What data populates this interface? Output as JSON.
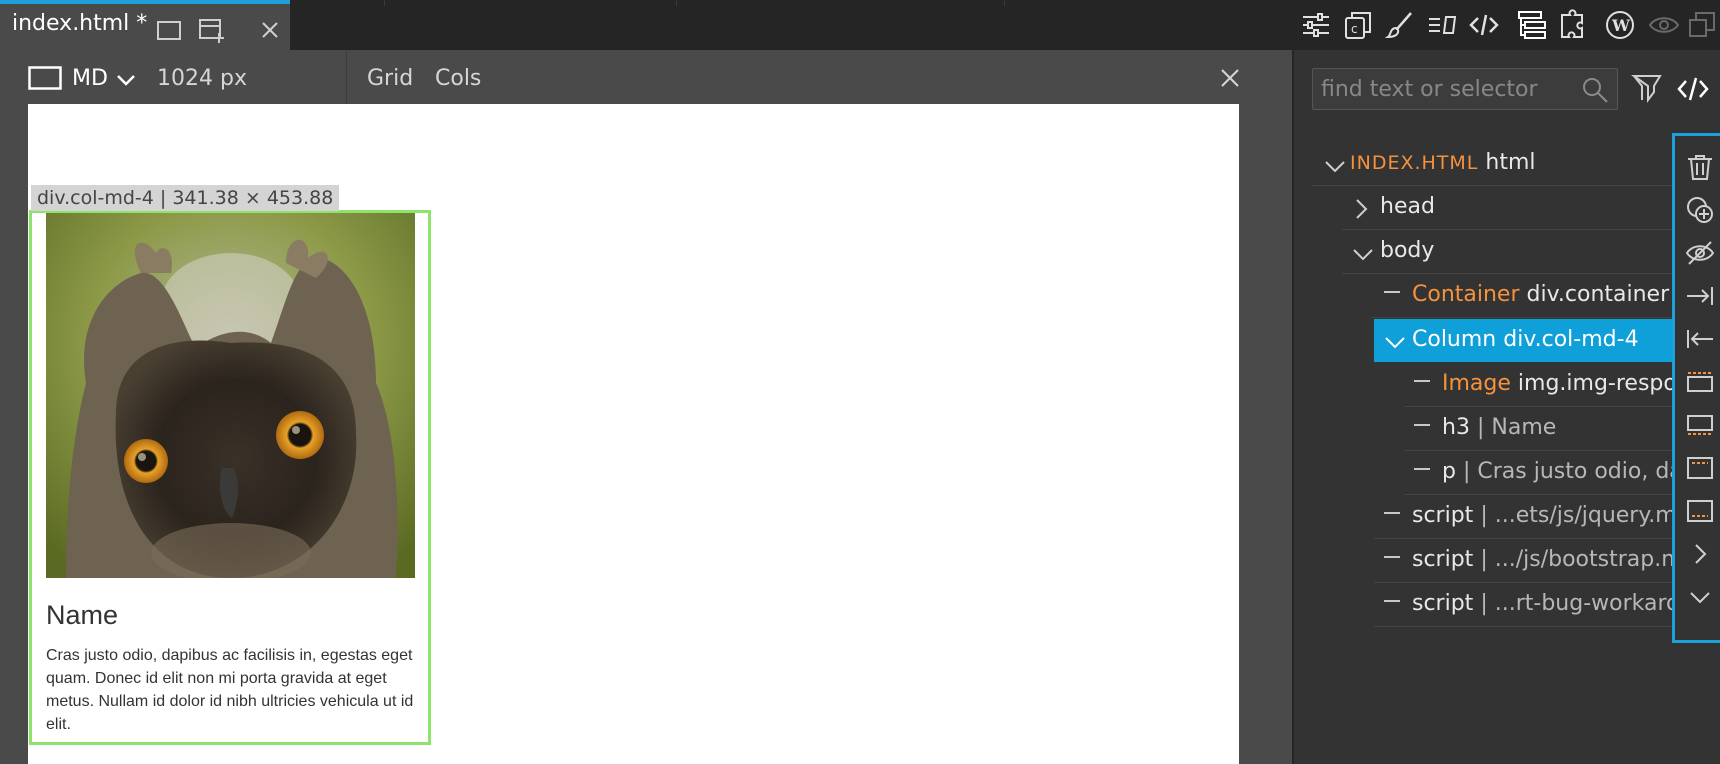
{
  "tab": {
    "title": "index.html *"
  },
  "toolbar": {
    "icons": [
      "sliders-icon",
      "components-icon",
      "brush-icon",
      "align-icon",
      "code-icon",
      "tree-icon",
      "plugins-icon",
      "wordpress-icon",
      "eye-icon",
      "duplicate-icon"
    ]
  },
  "canvas_toolbar": {
    "device": "MD",
    "width": "1024 px",
    "grid": "Grid",
    "cols": "Cols"
  },
  "selection": {
    "label": "div.col-md-4 | 341.38 × 453.88"
  },
  "card": {
    "heading": "Name",
    "body": "Cras justo odio, dapibus ac facilisis in, egestas eget quam. Donec id elit non mi porta gravida at eget metus. Nullam id dolor id nibh ultricies vehicula ut id elit."
  },
  "search": {
    "placeholder": "find text or selector"
  },
  "tree": {
    "root_type": "INDEX.HTML",
    "root_tag": "html",
    "head": "head",
    "body": "body",
    "container_type": "Container",
    "container_sel": "div.container",
    "column": "Column div.col-md-4",
    "image_type": "Image",
    "image_sel": "img.img-respon",
    "h3_tag": "h3",
    "h3_text": "Name",
    "p_tag": "p",
    "p_text": "Cras justo odio, da",
    "script1_tag": "script",
    "script1_text": "...ets/js/jquery.mi",
    "script2_tag": "script",
    "script2_text": ".../js/bootstrap.mi",
    "script3_tag": "script",
    "script3_text": "...rt-bug-workarou",
    "separator": "|"
  },
  "colors": {
    "accent": "#1ea0d8",
    "orange": "#f5923e",
    "selection": "#8ee36b"
  }
}
